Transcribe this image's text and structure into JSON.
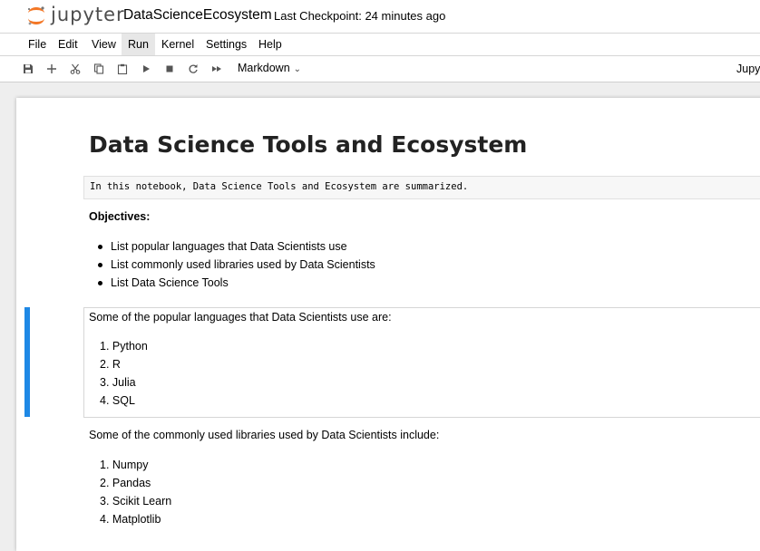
{
  "header": {
    "logo_text": "jupyter",
    "notebook_name": "DataScienceEcosystem",
    "checkpoint": "Last Checkpoint: 24 minutes ago"
  },
  "menubar": {
    "items": [
      "File",
      "Edit",
      "View",
      "Run",
      "Kernel",
      "Settings",
      "Help"
    ],
    "active": "Run"
  },
  "toolbar": {
    "buttons": [
      "save-icon",
      "add-cell-icon",
      "cut-icon",
      "copy-icon",
      "paste-icon",
      "run-icon",
      "stop-icon",
      "restart-icon",
      "fast-forward-icon"
    ],
    "cell_type": "Markdown",
    "kernel_partial": "Jupyt"
  },
  "notebook": {
    "title": "Data Science Tools and Ecosystem",
    "intro_code": "In this notebook, Data Science Tools and Ecosystem are summarized.",
    "objectives_heading": "Objectives:",
    "objectives": [
      "List popular languages that Data Scientists use",
      "List commonly used libraries used by Data Scientists",
      "List Data Science Tools"
    ],
    "languages_intro": "Some of the popular languages that Data Scientists use are:",
    "languages": [
      "1. Python",
      "2. R",
      "3. Julia",
      "4. SQL"
    ],
    "libraries_intro": "Some of the commonly used libraries used by Data Scientists include:",
    "libraries": [
      "1. Numpy",
      "2. Pandas",
      "3. Scikit Learn",
      "4. Matplotlib"
    ]
  },
  "colors": {
    "selection_bar": "#1e88e5",
    "logo_orange": "#f37726"
  }
}
